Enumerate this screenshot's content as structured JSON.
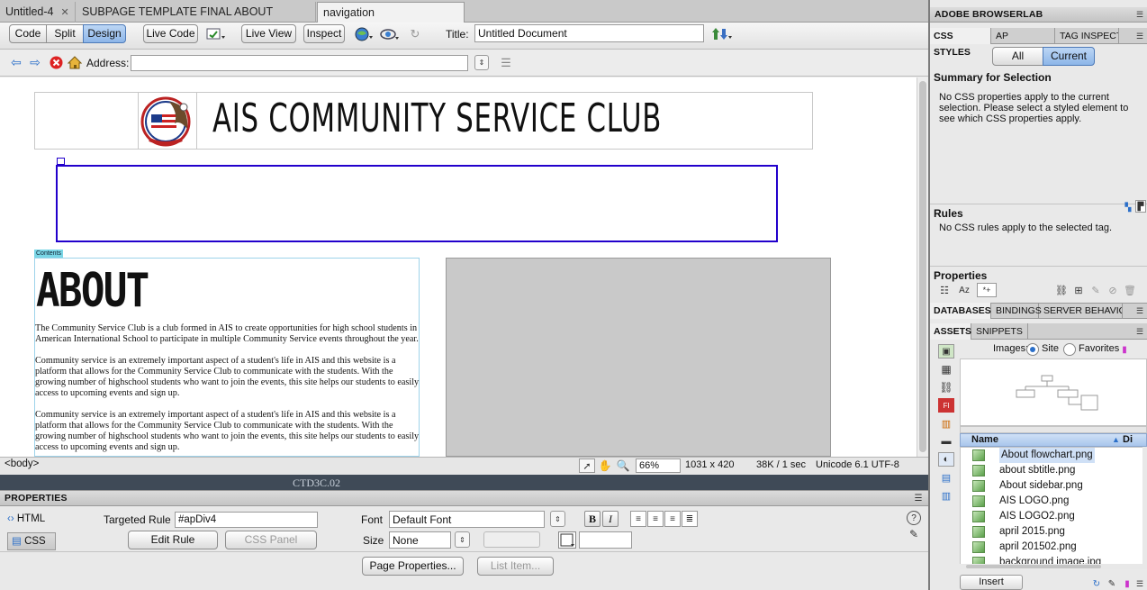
{
  "tabs": [
    {
      "label": "Untitled-4"
    },
    {
      "label": "SUBPAGE TEMPLATE FINAL ABOUT PAGE.dwt"
    },
    {
      "label": "navigation template.dwt*"
    }
  ],
  "view_buttons": {
    "code": "Code",
    "split": "Split",
    "design": "Design"
  },
  "toolbar": {
    "live_code": "Live Code",
    "live_view": "Live View",
    "inspect": "Inspect",
    "title_label": "Title:",
    "title_value": "Untitled Document"
  },
  "address": {
    "label": "Address:",
    "value": ""
  },
  "page": {
    "header_title": "AIS COMMUNITY SERVICE CLUB",
    "contents_tag": "Contents",
    "about_heading": "ABOUT",
    "paragraphs": [
      "The Community Service Club is a club formed in AIS to create opportunities for high school students in American International School to participate in multiple Community Service events throughout the year.",
      "Community service is an extremely important aspect of a student's life in AIS and this website is a platform that allows for the Community Service Club to communicate with the students. With the growing number of highschool students who want to join the events, this site helps our students to easily access to upcoming events and sign up.",
      "Community service is an extremely important aspect of a student's life in AIS and this website is a platform that allows for the Community Service Club to communicate with the students. With the growing number of highschool students who want to join the events, this site helps our students to easily access to upcoming events and sign up."
    ]
  },
  "status": {
    "tag": "<body>",
    "zoom": "66%",
    "dimensions": "1031 x 420",
    "size": "38K / 1 sec",
    "encoding": "Unicode 6.1 UTF-8",
    "behind_text": "CTD3C.02"
  },
  "properties": {
    "title": "PROPERTIES",
    "html": "HTML",
    "css": "CSS",
    "targeted_rule_label": "Targeted Rule",
    "targeted_rule_value": "#apDiv4",
    "edit_rule": "Edit Rule",
    "css_panel": "CSS Panel",
    "font_label": "Font",
    "font_value": "Default Font",
    "size_label": "Size",
    "size_value": "None",
    "bold": "B",
    "italic": "I",
    "page_properties": "Page Properties...",
    "list_item": "List Item..."
  },
  "right_panel": {
    "browserlab": "ADOBE BROWSERLAB",
    "tabs1": [
      "CSS STYLES",
      "AP ELEMENTS",
      "TAG INSPECTO"
    ],
    "all": "All",
    "current": "Current",
    "summary_title": "Summary for Selection",
    "summary_text": "No CSS properties apply to the current selection.  Please select a styled element to see which CSS properties apply.",
    "rules_title": "Rules",
    "rules_text": "No CSS rules apply to the selected tag.",
    "properties_title": "Properties",
    "tabs2": [
      "DATABASES",
      "BINDINGS",
      "SERVER BEHAVIOR"
    ],
    "tabs3": [
      "ASSETS",
      "SNIPPETS"
    ],
    "images_label": "Images:",
    "site": "Site",
    "favorites": "Favorites",
    "name_col": "Name",
    "di_col": "Di",
    "files": [
      "About flowchart.png",
      "about sbtitle.png",
      "About sidebar.png",
      "AIS LOGO.png",
      "AIS LOGO2.png",
      "april 2015.png",
      "april 201502.png",
      "background image.jpg"
    ],
    "insert": "Insert"
  },
  "colors": {
    "accent": "#8db6e8",
    "selection_border": "#2200cc",
    "contents_tag": "#7ad6e6"
  }
}
